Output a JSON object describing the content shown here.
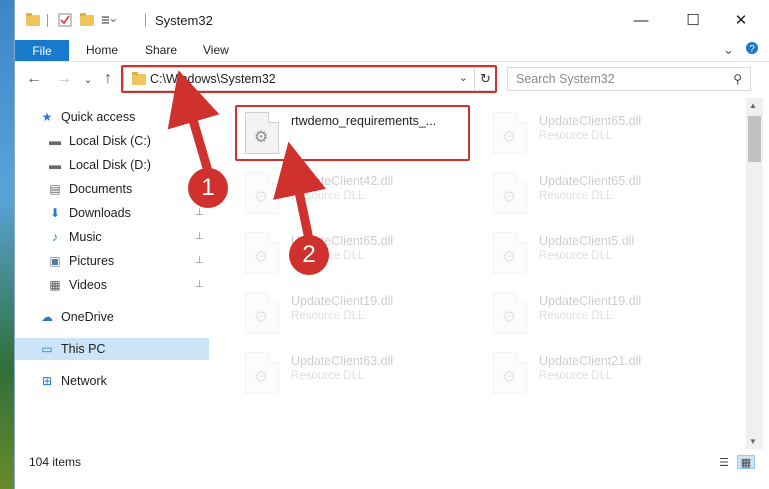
{
  "window": {
    "title": "System32",
    "controls": {
      "minimize": "—",
      "maximize": "☐",
      "close": "✕"
    }
  },
  "ribbon": {
    "tabs": [
      "File",
      "Home",
      "Share",
      "View"
    ],
    "expand_icon": "chevron-down-icon",
    "help_icon": "help-icon"
  },
  "navigation": {
    "back": "←",
    "forward": "→",
    "recent": "⌄",
    "up": "↑",
    "address": "C:\\Windows\\System32",
    "refresh": "↻",
    "search_placeholder": "Search System32",
    "search_icon": "⚲"
  },
  "sidebar": {
    "items": [
      {
        "label": "Quick access",
        "icon": "star-icon",
        "glyph": "★",
        "pinned": false
      },
      {
        "label": "Local Disk (C:)",
        "icon": "drive-icon",
        "glyph": "▬",
        "pinned": false
      },
      {
        "label": "Local Disk (D:)",
        "icon": "drive-icon",
        "glyph": "▬",
        "pinned": false
      },
      {
        "label": "Documents",
        "icon": "documents-icon",
        "glyph": "▤",
        "pinned": false
      },
      {
        "label": "Downloads",
        "icon": "downloads-icon",
        "glyph": "⬇",
        "pinned": true
      },
      {
        "label": "Music",
        "icon": "music-icon",
        "glyph": "♪",
        "pinned": true
      },
      {
        "label": "Pictures",
        "icon": "pictures-icon",
        "glyph": "▣",
        "pinned": true
      },
      {
        "label": "Videos",
        "icon": "videos-icon",
        "glyph": "▦",
        "pinned": true
      },
      {
        "label": "OneDrive",
        "icon": "cloud-icon",
        "glyph": "☁",
        "pinned": false
      },
      {
        "label": "This PC",
        "icon": "computer-icon",
        "glyph": "▭",
        "pinned": false,
        "selected": true
      },
      {
        "label": "Network",
        "icon": "network-icon",
        "glyph": "⊞",
        "pinned": false
      }
    ],
    "pin_glyph": "📌"
  },
  "files": [
    {
      "name": "rtwdemo_requirements_...",
      "type": "",
      "dim": false
    },
    {
      "name": "UpdateClient65.dll",
      "type": "Resource DLL",
      "dim": true
    },
    {
      "name": "UpdateClient42.dll",
      "type": "Resource DLL",
      "dim": true
    },
    {
      "name": "UpdateClient65.dll",
      "type": "Resource DLL",
      "dim": true
    },
    {
      "name": "UpdateClient65.dll",
      "type": "Resource DLL",
      "dim": true
    },
    {
      "name": "UpdateClient5.dll",
      "type": "Resource DLL",
      "dim": true
    },
    {
      "name": "UpdateClient19.dll",
      "type": "Resource DLL",
      "dim": true
    },
    {
      "name": "UpdateClient19.dll",
      "type": "Resource DLL",
      "dim": true
    },
    {
      "name": "UpdateClient63.dll",
      "type": "Resource DLL",
      "dim": true
    },
    {
      "name": "UpdateClient21.dll",
      "type": "Resource DLL",
      "dim": true
    }
  ],
  "status": {
    "item_count": "104 items"
  },
  "annotations": {
    "badge1": "1",
    "badge2": "2",
    "color": "#d0312d"
  },
  "colors": {
    "accent": "#1979ca",
    "selected": "#cce4f7",
    "highlight": "#d0312d"
  }
}
